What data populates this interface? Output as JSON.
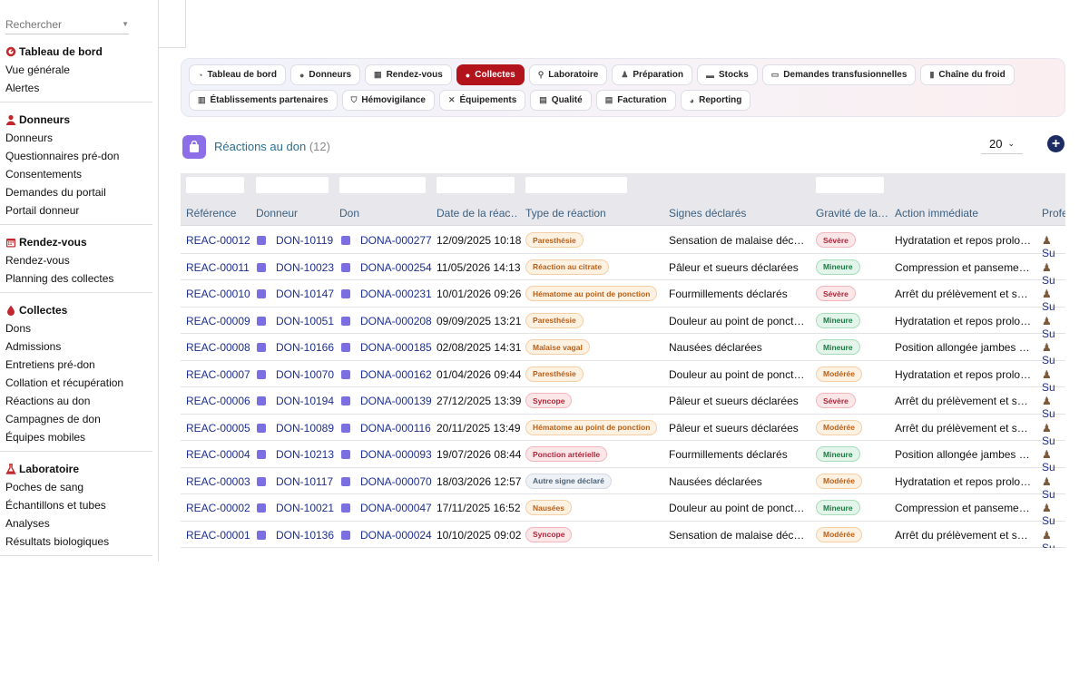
{
  "search": {
    "placeholder": "Rechercher"
  },
  "sidebar": {
    "sections": [
      {
        "title": "Tableau de bord",
        "icon": "gauge-icon",
        "items": [
          "Vue générale",
          "Alertes"
        ]
      },
      {
        "title": "Donneurs",
        "icon": "user-icon",
        "items": [
          "Donneurs",
          "Questionnaires pré-don",
          "Consentements",
          "Demandes du portail",
          "Portail donneur"
        ]
      },
      {
        "title": "Rendez-vous",
        "icon": "calendar-icon",
        "items": [
          "Rendez-vous",
          "Planning des collectes"
        ]
      },
      {
        "title": "Collectes",
        "icon": "drop-icon",
        "items": [
          "Dons",
          "Admissions",
          "Entretiens pré-don",
          "Collation et récupération",
          "Réactions au don",
          "Campagnes de don",
          "Équipes mobiles"
        ]
      },
      {
        "title": "Laboratoire",
        "icon": "flask-icon",
        "items": [
          "Poches de sang",
          "Échantillons et tubes",
          "Analyses",
          "Résultats biologiques"
        ]
      }
    ]
  },
  "nav": {
    "row1": [
      {
        "label": "Tableau de bord",
        "icon": "gauge-icon"
      },
      {
        "label": "Donneurs",
        "icon": "user-icon"
      },
      {
        "label": "Rendez-vous",
        "icon": "calendar-icon"
      },
      {
        "label": "Collectes",
        "icon": "drop-icon",
        "active": true
      },
      {
        "label": "Laboratoire",
        "icon": "microscope-icon"
      },
      {
        "label": "Préparation",
        "icon": "person-icon"
      },
      {
        "label": "Stocks",
        "icon": "warehouse-icon"
      },
      {
        "label": "Demandes transfusionnelles",
        "icon": "document-icon"
      },
      {
        "label": "Chaîne du froid",
        "icon": "thermometer-icon"
      }
    ],
    "row2": [
      {
        "label": "Établissements partenaires",
        "icon": "building-icon"
      },
      {
        "label": "Hémovigilance",
        "icon": "shield-icon"
      },
      {
        "label": "Équipements",
        "icon": "tools-icon"
      },
      {
        "label": "Qualité",
        "icon": "clipboard-icon"
      },
      {
        "label": "Facturation",
        "icon": "invoice-icon"
      },
      {
        "label": "Reporting",
        "icon": "chart-icon"
      }
    ]
  },
  "header": {
    "title": "Réactions au don",
    "count": "(12)",
    "page_size": "20",
    "add": "+"
  },
  "table": {
    "columns": [
      "Référence",
      "Donneur",
      "Don",
      "Date de la réac…",
      "Type de réaction",
      "Signes déclarés",
      "Gravité de la…",
      "Action immédiate",
      "Profe"
    ],
    "rows": [
      {
        "ref": "REAC-00012",
        "donneur": "DON-10119",
        "don": "DONA-000277",
        "date": "12/09/2025 10:18",
        "type": "Paresthésie",
        "type_tone": "orange",
        "signes": "Sensation de malaise déclar…",
        "gravite": "Sévère",
        "action": "Hydratation et repos prolongé",
        "prof": "Su"
      },
      {
        "ref": "REAC-00011",
        "donneur": "DON-10023",
        "don": "DONA-000254",
        "date": "11/05/2026 14:13",
        "type": "Réaction au citrate",
        "type_tone": "orange",
        "signes": "Pâleur et sueurs déclarées",
        "gravite": "Mineure",
        "action": "Compression et pansement …",
        "prof": "Su"
      },
      {
        "ref": "REAC-00010",
        "donneur": "DON-10147",
        "don": "DONA-000231",
        "date": "10/01/2026 09:26",
        "type": "Hématome au point de ponction",
        "type_tone": "orange",
        "signes": "Fourmillements déclarés",
        "gravite": "Sévère",
        "action": "Arrêt du prélèvement et sur…",
        "prof": "Su"
      },
      {
        "ref": "REAC-00009",
        "donneur": "DON-10051",
        "don": "DONA-000208",
        "date": "09/09/2025 13:21",
        "type": "Paresthésie",
        "type_tone": "orange",
        "signes": "Douleur au point de ponction",
        "gravite": "Mineure",
        "action": "Hydratation et repos prolongé",
        "prof": "Su"
      },
      {
        "ref": "REAC-00008",
        "donneur": "DON-10166",
        "don": "DONA-000185",
        "date": "02/08/2025 14:31",
        "type": "Malaise vagal",
        "type_tone": "orange",
        "signes": "Nausées déclarées",
        "gravite": "Mineure",
        "action": "Position allongée jambes su…",
        "prof": "Su"
      },
      {
        "ref": "REAC-00007",
        "donneur": "DON-10070",
        "don": "DONA-000162",
        "date": "01/04/2026 09:44",
        "type": "Paresthésie",
        "type_tone": "orange",
        "signes": "Douleur au point de ponction",
        "gravite": "Modérée",
        "action": "Hydratation et repos prolongé",
        "prof": "Su"
      },
      {
        "ref": "REAC-00006",
        "donneur": "DON-10194",
        "don": "DONA-000139",
        "date": "27/12/2025 13:39",
        "type": "Syncope",
        "type_tone": "red",
        "signes": "Pâleur et sueurs déclarées",
        "gravite": "Sévère",
        "action": "Arrêt du prélèvement et sur…",
        "prof": "Su"
      },
      {
        "ref": "REAC-00005",
        "donneur": "DON-10089",
        "don": "DONA-000116",
        "date": "20/11/2025 13:49",
        "type": "Hématome au point de ponction",
        "type_tone": "orange",
        "signes": "Pâleur et sueurs déclarées",
        "gravite": "Modérée",
        "action": "Arrêt du prélèvement et sur…",
        "prof": "Su"
      },
      {
        "ref": "REAC-00004",
        "donneur": "DON-10213",
        "don": "DONA-000093",
        "date": "19/07/2026 08:44",
        "type": "Ponction artérielle",
        "type_tone": "red",
        "signes": "Fourmillements déclarés",
        "gravite": "Mineure",
        "action": "Position allongée jambes su…",
        "prof": "Su"
      },
      {
        "ref": "REAC-00003",
        "donneur": "DON-10117",
        "don": "DONA-000070",
        "date": "18/03/2026 12:57",
        "type": "Autre signe déclaré",
        "type_tone": "gray",
        "signes": "Nausées déclarées",
        "gravite": "Modérée",
        "action": "Hydratation et repos prolongé",
        "prof": "Su"
      },
      {
        "ref": "REAC-00002",
        "donneur": "DON-10021",
        "don": "DONA-000047",
        "date": "17/11/2025 16:52",
        "type": "Nausées",
        "type_tone": "orange",
        "signes": "Douleur au point de ponction",
        "gravite": "Mineure",
        "action": "Compression et pansement …",
        "prof": "Su"
      },
      {
        "ref": "REAC-00001",
        "donneur": "DON-10136",
        "don": "DONA-000024",
        "date": "10/10/2025 09:02",
        "type": "Syncope",
        "type_tone": "red",
        "signes": "Sensation de malaise déclar…",
        "gravite": "Modérée",
        "action": "Arrêt du prélèvement et sur…",
        "prof": "Su"
      }
    ]
  },
  "colors": {
    "accent_red": "#b3141c",
    "link": "#1d2f8f",
    "header_text": "#2c6e8e",
    "add_button": "#1d2d63"
  }
}
